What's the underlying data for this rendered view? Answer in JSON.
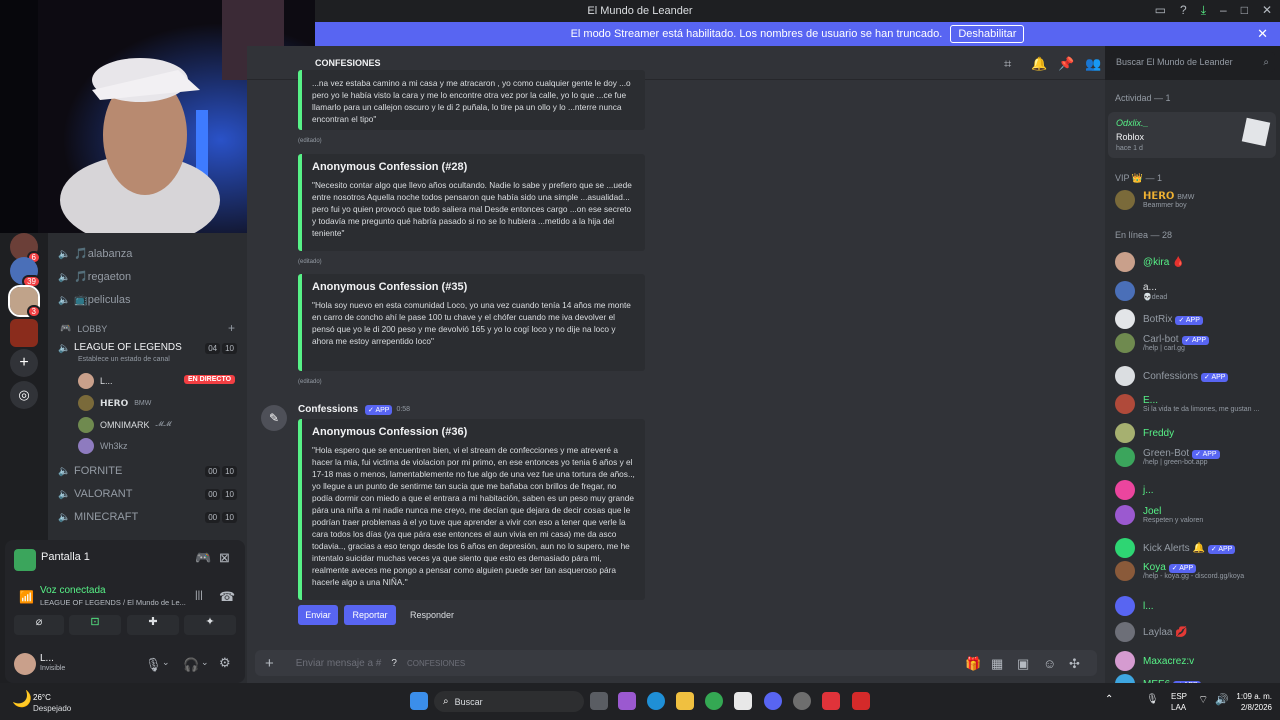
{
  "window": {
    "title": "El Mundo de Leander"
  },
  "streamer_banner": {
    "text": "El modo Streamer está habilitado. Los nombres de usuario se han truncado.",
    "button": "Deshabilitar"
  },
  "channel_header": {
    "name": "CONFESIONES",
    "search_placeholder": "Buscar El Mundo de Leander"
  },
  "channels": {
    "voice_top": [
      "🎵alabanza",
      "🎵regaeton",
      "📺peliculas"
    ],
    "lobby_category": "LOBBY",
    "lobby_channel": {
      "name": "LEAGUE OF LEGENDS",
      "status": "Establece un estado de canal",
      "c1": "04",
      "c2": "10"
    },
    "lobby_users": [
      {
        "name": "L...",
        "tag": "EN DIRECTO"
      },
      {
        "name": "𝗛𝗘𝗥𝗢",
        "tag": "BMW"
      },
      {
        "name": "OMNIMARK",
        "tag": "𝓜𝓜"
      },
      {
        "name": "Wh3kz",
        "tag": ""
      }
    ],
    "other": [
      {
        "name": "FORNITE",
        "c1": "00",
        "c2": "10"
      },
      {
        "name": "VALORANT",
        "c1": "00",
        "c2": "10"
      },
      {
        "name": "MINECRAFT",
        "c1": "00",
        "c2": "10"
      }
    ],
    "server_badges": [
      "6",
      "39",
      "3"
    ]
  },
  "voice_panel": {
    "activity": "Pantalla 1",
    "status": "Voz conectada",
    "location": "LEAGUE OF LEGENDS / El Mundo de Le...",
    "user": "L...",
    "user_status": "Invisible"
  },
  "messages": {
    "embed1_text": "...na vez estaba camino a mi casa y me atracaron , yo como cualquier gente le doy ...o pero yo le había visto la cara y me lo encontre otra vez por la calle, yo lo que ...ce fue llamarlo para un callejon oscuro y le di 2 puñala, lo tire pa un ollo y lo ...nterre nunca encontran el tipo\"",
    "embed1_edited": "(editado)",
    "embed2_title": "Anonymous Confession (#28)",
    "embed2_text": "\"Necesito contar algo que llevo años ocultando. Nadie lo sabe y prefiero que se ...uede entre nosotros Aquella noche todos pensaron que había sido una simple ...asualidad... pero fui yo quien provocó que todo saliera mal Desde entonces cargo ...on ese secreto y todavía me pregunto qué habría pasado si no se lo hubiera ...metido a la hija del teniente\"",
    "embed2_edited": "(editado)",
    "embed3_title": "Anonymous Confession (#35)",
    "embed3_text": "\"Hola soy nuevo en esta comunidad Loco, yo una vez cuando tenía 14 años me monte en carro de concho ahí le pase 100 tu chave y el chófer cuando me iva devolver el pensó que yo le di 200 peso y me devolvió 165 y yo lo cogí loco y no dije na loco y ahora me estoy arrepentido loco\"",
    "embed3_edited": "(editado)",
    "author": "Confessions",
    "author_badge": "✓ APP",
    "time": "0:58",
    "embed4_title": "Anonymous Confession (#36)",
    "embed4_text": "\"Hola espero que se encuentren bien, vi el stream de confecciones y me atreveré a hacer la mia, fui victima de violacion por mi primo, en ese entonces yo tenia 6 años y el 17-18 mas o menos, lamentablemente no fue algo de una vez fue una tortura de años.., yo llegue a un punto de sentirme tan sucia que me bañaba con brillos de fregar, no podía dormir con miedo a que el entrara a mi habitación, saben es un peso muy grande pára una niña a mi nadie nunca me creyo, me decían que dejara de decir cosas que le podrían traer problemas à el yo tuve que aprender a vivir con eso a tener que verle la cara todos los días (ya que pára ese entonces el aun vivia en mi casa) me da asco todavia.., gracias a eso tengo desde los 6 años en depresión, aun no lo supero, me he intentalo suicidar muchas veces ya que siento que esto es demasiado pára mi, realmente aveces me pongo a pensar como alguien puede ser tan asqueroso pára hacerle algo a una NIÑA.\"",
    "btn_send": "Enviar",
    "btn_report": "Reportar",
    "btn_reply": "Responder",
    "composer_placeholder": "Enviar mensaje a #",
    "composer_channel": "CONFESIONES"
  },
  "members": {
    "activity_header": "Actividad — 1",
    "activity_user": "Odxlix._",
    "activity_game": "Roblox",
    "activity_time": "hace 1 d",
    "vip_header": "VIP 👑 — 1",
    "vip_user": "𝗛𝗘𝗥𝗢",
    "vip_tag": "BMW",
    "vip_sub": "Beammer boy",
    "online_header": "En línea — 28",
    "list": [
      {
        "name": "@kira 🩸",
        "sub": "",
        "app": false,
        "color": "#57f287"
      },
      {
        "name": "a...",
        "sub": "💀dead",
        "app": false,
        "color": "#dbdee1"
      },
      {
        "name": "BotRix",
        "sub": "",
        "app": true,
        "color": "#949ba4"
      },
      {
        "name": "Carl-bot",
        "sub": "/help | carl.gg",
        "app": true,
        "color": "#949ba4"
      },
      {
        "name": "Confessions",
        "sub": "",
        "app": true,
        "color": "#949ba4"
      },
      {
        "name": "E...",
        "sub": "Si la vida te da limones, me gustan ...",
        "app": false,
        "color": "#57f287"
      },
      {
        "name": "Freddy",
        "sub": "",
        "app": false,
        "color": "#57f287"
      },
      {
        "name": "Green-Bot",
        "sub": "/help | green-bot.app",
        "app": true,
        "color": "#949ba4"
      },
      {
        "name": "j...",
        "sub": "",
        "app": false,
        "color": "#57f287"
      },
      {
        "name": "Joel",
        "sub": "Respeten y valoren",
        "app": false,
        "color": "#57f287"
      },
      {
        "name": "Kick Alerts 🔔",
        "sub": "",
        "app": true,
        "color": "#949ba4"
      },
      {
        "name": "Koya",
        "sub": "/help - koya.gg - discord.gg/koya",
        "app": true,
        "color": "#57f287"
      },
      {
        "name": "l...",
        "sub": "",
        "app": false,
        "color": "#57f287"
      },
      {
        "name": "Laylaa 💋",
        "sub": "",
        "app": false,
        "color": "#949ba4"
      },
      {
        "name": "Maxacrez:v",
        "sub": "",
        "app": false,
        "color": "#57f287"
      },
      {
        "name": "MEE6",
        "sub": "",
        "app": true,
        "color": "#57f287"
      }
    ]
  },
  "taskbar": {
    "weather_temp": "26°C",
    "weather_desc": "Despejado",
    "search": "Buscar",
    "lang1": "ESP",
    "lang2": "LAA",
    "time": "1:09 a. m.",
    "date": "2/8/2026"
  },
  "colors": {
    "accent": "#5865f2",
    "green": "#57f287",
    "red": "#f23f43",
    "bg": "#313338"
  }
}
